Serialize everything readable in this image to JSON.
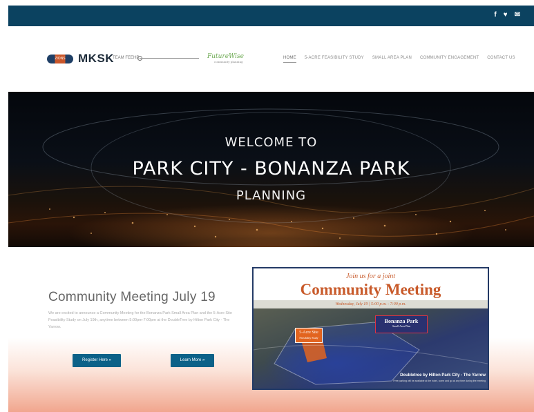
{
  "social": {
    "icons": [
      "facebook-icon",
      "twitter-icon",
      "email-icon"
    ],
    "facebook": "f",
    "twitter": "♥",
    "email": "✉"
  },
  "header": {
    "logos": {
      "badge_text": "ZIONS",
      "mksk": "MKSK",
      "team1": "TEAM FEEHR",
      "futurewise": "FutureWise",
      "futurewise_sub": "community planning"
    },
    "nav": [
      {
        "label": "HOME"
      },
      {
        "label": "5-ACRE FEASIBILITY STUDY"
      },
      {
        "label": "SMALL AREA PLAN"
      },
      {
        "label": "COMMUNITY ENGAGEMENT"
      },
      {
        "label": "CONTACT US"
      }
    ]
  },
  "hero": {
    "line1": "WELCOME TO",
    "line2": "PARK CITY - BONANZA PARK",
    "line3": "PLANNING"
  },
  "meeting": {
    "title": "Community Meeting July 19",
    "text": "We are excited to announce a Community Meeting for the Bonanza Park Small Area Plan and the 5-Acre Site Feasibility Study on July 19th, anytime between 5:00pm-7:00pm at the DoubleTree by Hilton Park City - The Yarrow.",
    "btn_register": "Register Here »",
    "btn_learn": "Learn More »"
  },
  "flyer": {
    "join": "Join us for a joint",
    "title": "Community Meeting",
    "date": "Wednesday, July 19 | 5:00 p.m. - 7:00 p.m.",
    "acre": "5-Acre Site",
    "acre_sub": "Feasibility Study",
    "bonanza": "Bonanza Park",
    "bonanza_sub": "Small Area Plan",
    "doubletree": "Doubletree by Hilton Park City - The Yarrow",
    "small_print": "Free parking will be available at the hotel, come and go at any time during the meeting"
  },
  "colors": {
    "topbar": "#0b4260",
    "button": "#0c6188",
    "flyer_accent": "#c85a2a",
    "flyer_border": "#233a66"
  }
}
